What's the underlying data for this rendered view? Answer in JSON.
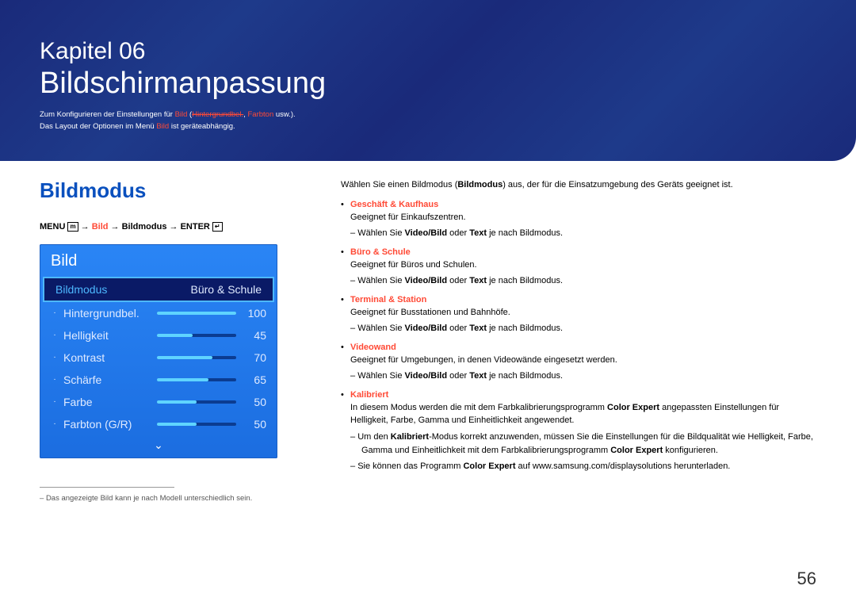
{
  "banner": {
    "chapter_num": "Kapitel 06",
    "chapter_title": "Bildschirmanpassung",
    "desc_prefix": "Zum Konfigurieren der Einstellungen für ",
    "desc_bild": "Bild",
    "desc_paren_open": " (",
    "desc_hinter": "Hintergrundbel.",
    "desc_sep": ", ",
    "desc_farbton": "Farbton",
    "desc_suffix": " usw.).",
    "desc_line2_prefix": "Das Layout der Optionen im Menü ",
    "desc_line2_bild": "Bild",
    "desc_line2_suffix": " ist geräteabhängig."
  },
  "left": {
    "section_heading": "Bildmodus",
    "menu_path": {
      "menu": "MENU",
      "icon1": "m",
      "arrow1": " → ",
      "bild": "Bild",
      "arrow2": " → ",
      "bildmodus": "Bildmodus",
      "arrow3": " → ",
      "enter": "ENTER",
      "icon2": "↵"
    },
    "osd": {
      "title": "Bild",
      "active": {
        "label": "Bildmodus",
        "value": "Büro & Schule"
      },
      "rows": [
        {
          "label": "Hintergrundbel.",
          "value": 100,
          "pct": 100
        },
        {
          "label": "Helligkeit",
          "value": 45,
          "pct": 45
        },
        {
          "label": "Kontrast",
          "value": 70,
          "pct": 70
        },
        {
          "label": "Schärfe",
          "value": 65,
          "pct": 65
        },
        {
          "label": "Farbe",
          "value": 50,
          "pct": 50
        },
        {
          "label": "Farbton (G/R)",
          "value": 50,
          "pct": 50
        }
      ],
      "chevron": "⌄"
    },
    "footnote_prefix": "‒ ",
    "footnote": "Das angezeigte Bild kann je nach Modell unterschiedlich sein."
  },
  "right": {
    "intro_prefix": "Wählen Sie einen Bildmodus (",
    "intro_bold": "Bildmodus",
    "intro_suffix": ") aus, der für die Einsatzumgebung des Geräts geeignet ist.",
    "modes": [
      {
        "name": "Geschäft & Kaufhaus",
        "desc": "Geeignet für Einkaufszentren.",
        "sub": [
          {
            "pre": "Wählen Sie ",
            "b1": "Video/Bild",
            "mid": " oder ",
            "b2": "Text",
            "post": " je nach Bildmodus."
          }
        ]
      },
      {
        "name": "Büro & Schule",
        "desc": "Geeignet für Büros und Schulen.",
        "sub": [
          {
            "pre": "Wählen Sie ",
            "b1": "Video/Bild",
            "mid": " oder ",
            "b2": "Text",
            "post": " je nach Bildmodus."
          }
        ]
      },
      {
        "name": "Terminal & Station",
        "desc": "Geeignet für Busstationen und Bahnhöfe.",
        "sub": [
          {
            "pre": "Wählen Sie ",
            "b1": "Video/Bild",
            "mid": " oder ",
            "b2": "Text",
            "post": " je nach Bildmodus."
          }
        ]
      },
      {
        "name": "Videowand",
        "desc": "Geeignet für Umgebungen, in denen Videowände eingesetzt werden.",
        "sub": [
          {
            "pre": "Wählen Sie ",
            "b1": "Video/Bild",
            "mid": " oder ",
            "b2": "Text",
            "post": " je nach Bildmodus."
          }
        ]
      },
      {
        "name": "Kalibriert",
        "desc_pre": "In diesem Modus werden die mit dem Farbkalibrierungsprogramm ",
        "desc_b": "Color Expert",
        "desc_post": " angepassten Einstellungen für Helligkeit, Farbe, Gamma und Einheitlichkeit angewendet.",
        "sub": [
          {
            "pre": "Um den ",
            "b1": "Kalibriert",
            "mid": "-Modus korrekt anzuwenden, müssen Sie die Einstellungen für die Bildqualität wie Helligkeit, Farbe, Gamma und Einheitlichkeit mit dem Farbkalibrierungsprogramm ",
            "b2": "Color Expert",
            "post": " konfigurieren."
          },
          {
            "pre": "Sie können das Programm ",
            "b1": "Color Expert",
            "mid": " auf www.samsung.com/displaysolutions herunterladen.",
            "b2": "",
            "post": ""
          }
        ]
      }
    ]
  },
  "page_num": "56"
}
